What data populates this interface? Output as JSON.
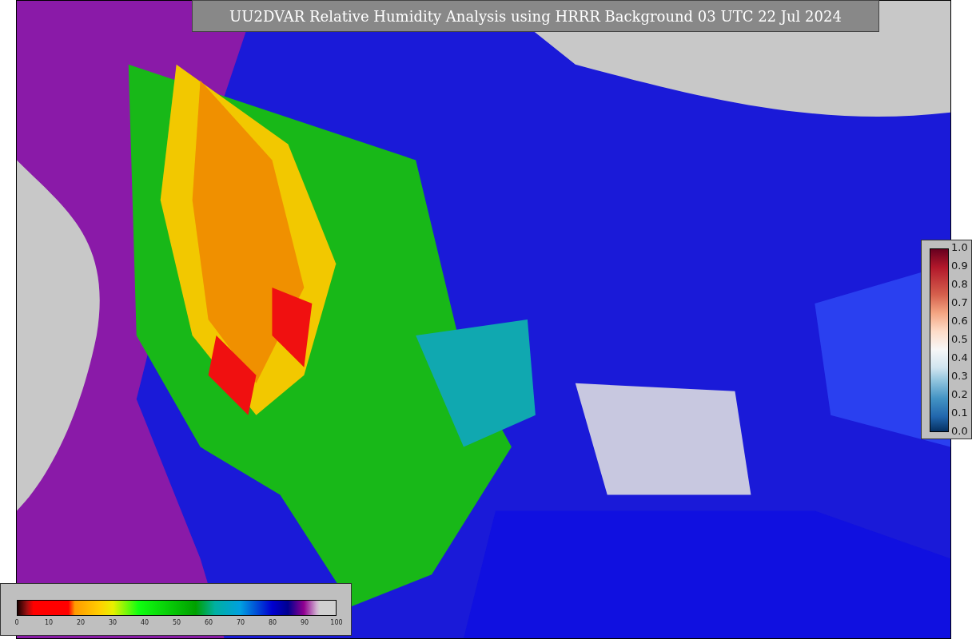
{
  "title": "UU2DVAR Relative Humidity Analysis using HRRR Background 03 UTC 22 Jul 2024",
  "humidity_colorbar": {
    "ticks": [
      "0",
      "10",
      "20",
      "30",
      "40",
      "50",
      "60",
      "70",
      "80",
      "90",
      "100"
    ]
  },
  "observation_colorbar": {
    "ticks": [
      "1.0",
      "0.9",
      "0.8",
      "0.7",
      "0.6",
      "0.5",
      "0.4",
      "0.3",
      "0.2",
      "0.1",
      "0.0"
    ]
  }
}
